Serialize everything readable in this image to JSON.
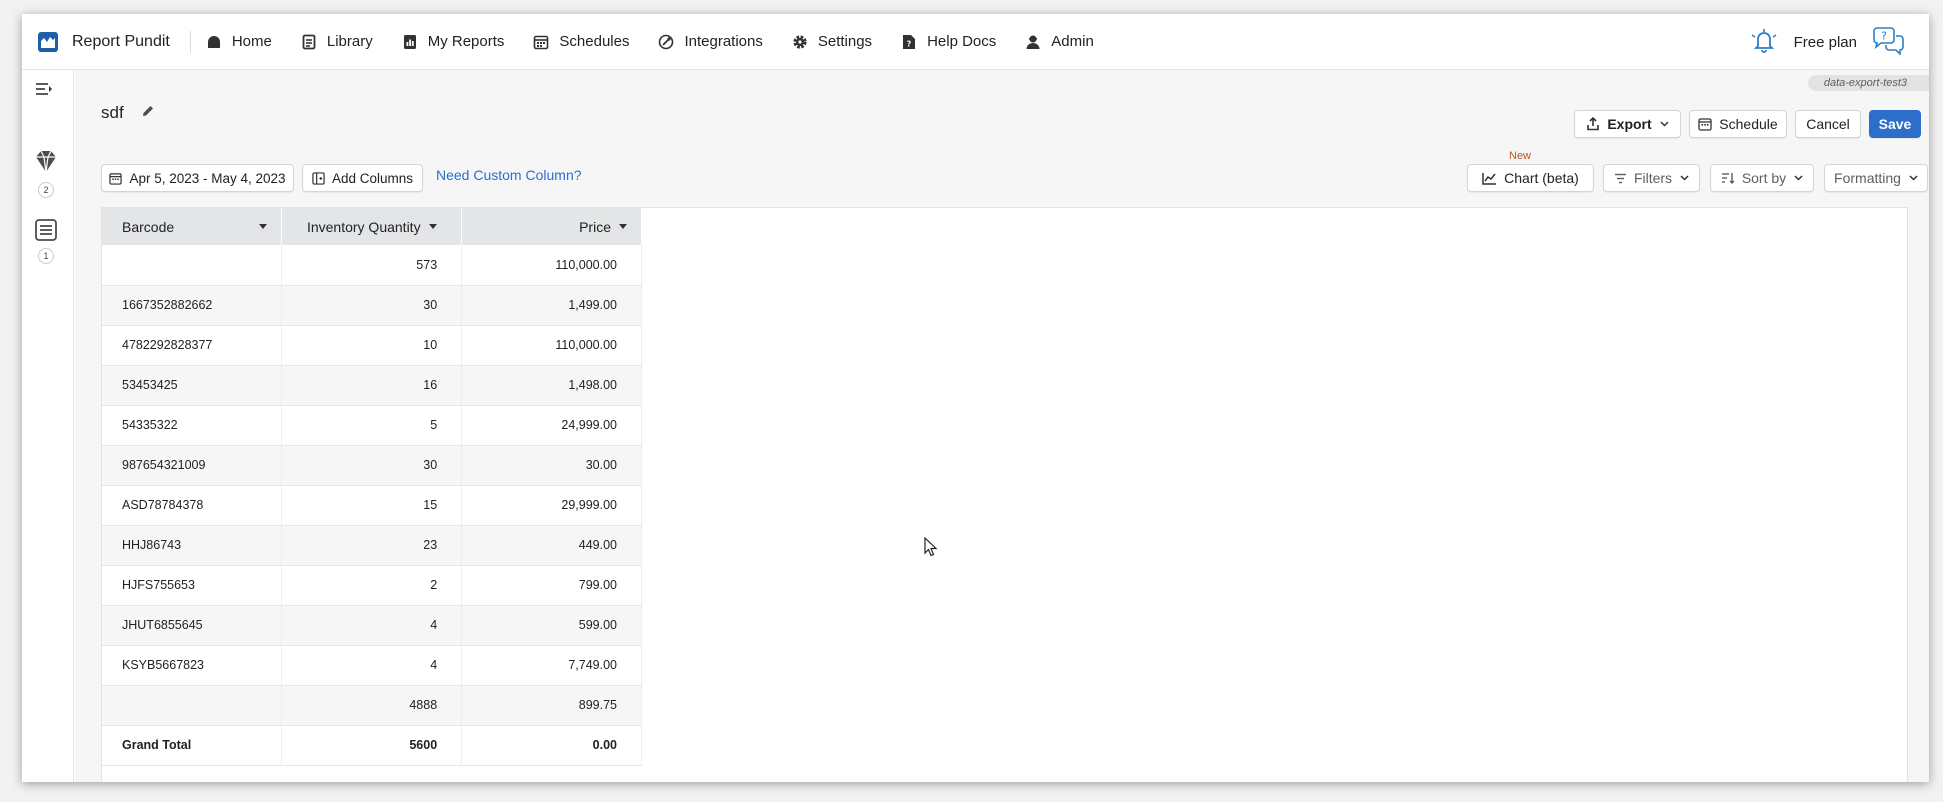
{
  "app": {
    "name": "Report Pundit",
    "plan": "Free plan"
  },
  "nav": {
    "items": [
      {
        "label": "Home",
        "icon": "home-icon"
      },
      {
        "label": "Library",
        "icon": "library-icon"
      },
      {
        "label": "My Reports",
        "icon": "reports-icon"
      },
      {
        "label": "Schedules",
        "icon": "calendar-icon"
      },
      {
        "label": "Integrations",
        "icon": "integrations-icon"
      },
      {
        "label": "Settings",
        "icon": "gear-icon"
      },
      {
        "label": "Help Docs",
        "icon": "help-docs-icon"
      },
      {
        "label": "Admin",
        "icon": "admin-icon"
      }
    ]
  },
  "rail": {
    "badge1": "2",
    "badge2": "1"
  },
  "report": {
    "name": "sdf",
    "tag": "data-export-test3",
    "date_range": "Apr 5, 2023 - May 4, 2023",
    "add_columns": "Add Columns",
    "custom_column_link": "Need Custom Column?",
    "new_badge": "New"
  },
  "toolbar": {
    "export": "Export",
    "schedule": "Schedule",
    "cancel": "Cancel",
    "save": "Save",
    "chart": "Chart (beta)",
    "filters": "Filters",
    "sort_by": "Sort by",
    "formatting": "Formatting"
  },
  "table": {
    "headers": [
      "Barcode",
      "Inventory Quantity",
      "Price"
    ],
    "rows": [
      [
        "",
        "573",
        "110,000.00"
      ],
      [
        "1667352882662",
        "30",
        "1,499.00"
      ],
      [
        "4782292828377",
        "10",
        "110,000.00"
      ],
      [
        "53453425",
        "16",
        "1,498.00"
      ],
      [
        "54335322",
        "5",
        "24,999.00"
      ],
      [
        "987654321009",
        "30",
        "30.00"
      ],
      [
        "ASD78784378",
        "15",
        "29,999.00"
      ],
      [
        "HHJ86743",
        "23",
        "449.00"
      ],
      [
        "HJFS755653",
        "2",
        "799.00"
      ],
      [
        "JHUT6855645",
        "4",
        "599.00"
      ],
      [
        "KSYB5667823",
        "4",
        "7,749.00"
      ],
      [
        "",
        "4888",
        "899.75"
      ]
    ],
    "total": [
      "Grand Total",
      "5600",
      "0.00"
    ]
  }
}
